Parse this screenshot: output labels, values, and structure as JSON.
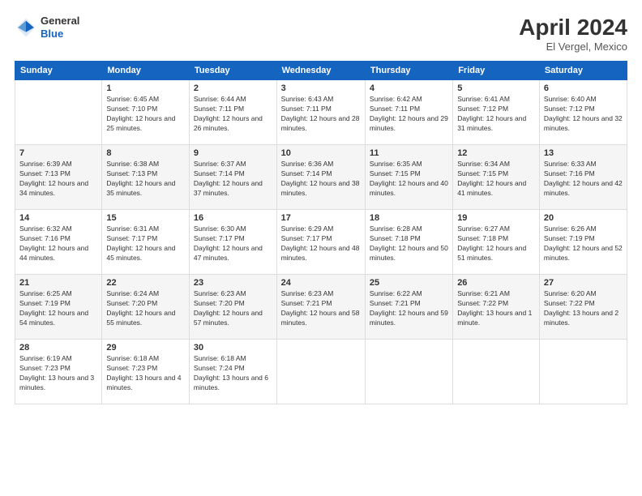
{
  "header": {
    "logo": {
      "general": "General",
      "blue": "Blue"
    },
    "title": "April 2024",
    "location": "El Vergel, Mexico"
  },
  "weekdays": [
    "Sunday",
    "Monday",
    "Tuesday",
    "Wednesday",
    "Thursday",
    "Friday",
    "Saturday"
  ],
  "weeks": [
    [
      {
        "day": "",
        "sunrise": "",
        "sunset": "",
        "daylight": ""
      },
      {
        "day": "1",
        "sunrise": "Sunrise: 6:45 AM",
        "sunset": "Sunset: 7:10 PM",
        "daylight": "Daylight: 12 hours and 25 minutes."
      },
      {
        "day": "2",
        "sunrise": "Sunrise: 6:44 AM",
        "sunset": "Sunset: 7:11 PM",
        "daylight": "Daylight: 12 hours and 26 minutes."
      },
      {
        "day": "3",
        "sunrise": "Sunrise: 6:43 AM",
        "sunset": "Sunset: 7:11 PM",
        "daylight": "Daylight: 12 hours and 28 minutes."
      },
      {
        "day": "4",
        "sunrise": "Sunrise: 6:42 AM",
        "sunset": "Sunset: 7:11 PM",
        "daylight": "Daylight: 12 hours and 29 minutes."
      },
      {
        "day": "5",
        "sunrise": "Sunrise: 6:41 AM",
        "sunset": "Sunset: 7:12 PM",
        "daylight": "Daylight: 12 hours and 31 minutes."
      },
      {
        "day": "6",
        "sunrise": "Sunrise: 6:40 AM",
        "sunset": "Sunset: 7:12 PM",
        "daylight": "Daylight: 12 hours and 32 minutes."
      }
    ],
    [
      {
        "day": "7",
        "sunrise": "Sunrise: 6:39 AM",
        "sunset": "Sunset: 7:13 PM",
        "daylight": "Daylight: 12 hours and 34 minutes."
      },
      {
        "day": "8",
        "sunrise": "Sunrise: 6:38 AM",
        "sunset": "Sunset: 7:13 PM",
        "daylight": "Daylight: 12 hours and 35 minutes."
      },
      {
        "day": "9",
        "sunrise": "Sunrise: 6:37 AM",
        "sunset": "Sunset: 7:14 PM",
        "daylight": "Daylight: 12 hours and 37 minutes."
      },
      {
        "day": "10",
        "sunrise": "Sunrise: 6:36 AM",
        "sunset": "Sunset: 7:14 PM",
        "daylight": "Daylight: 12 hours and 38 minutes."
      },
      {
        "day": "11",
        "sunrise": "Sunrise: 6:35 AM",
        "sunset": "Sunset: 7:15 PM",
        "daylight": "Daylight: 12 hours and 40 minutes."
      },
      {
        "day": "12",
        "sunrise": "Sunrise: 6:34 AM",
        "sunset": "Sunset: 7:15 PM",
        "daylight": "Daylight: 12 hours and 41 minutes."
      },
      {
        "day": "13",
        "sunrise": "Sunrise: 6:33 AM",
        "sunset": "Sunset: 7:16 PM",
        "daylight": "Daylight: 12 hours and 42 minutes."
      }
    ],
    [
      {
        "day": "14",
        "sunrise": "Sunrise: 6:32 AM",
        "sunset": "Sunset: 7:16 PM",
        "daylight": "Daylight: 12 hours and 44 minutes."
      },
      {
        "day": "15",
        "sunrise": "Sunrise: 6:31 AM",
        "sunset": "Sunset: 7:17 PM",
        "daylight": "Daylight: 12 hours and 45 minutes."
      },
      {
        "day": "16",
        "sunrise": "Sunrise: 6:30 AM",
        "sunset": "Sunset: 7:17 PM",
        "daylight": "Daylight: 12 hours and 47 minutes."
      },
      {
        "day": "17",
        "sunrise": "Sunrise: 6:29 AM",
        "sunset": "Sunset: 7:17 PM",
        "daylight": "Daylight: 12 hours and 48 minutes."
      },
      {
        "day": "18",
        "sunrise": "Sunrise: 6:28 AM",
        "sunset": "Sunset: 7:18 PM",
        "daylight": "Daylight: 12 hours and 50 minutes."
      },
      {
        "day": "19",
        "sunrise": "Sunrise: 6:27 AM",
        "sunset": "Sunset: 7:18 PM",
        "daylight": "Daylight: 12 hours and 51 minutes."
      },
      {
        "day": "20",
        "sunrise": "Sunrise: 6:26 AM",
        "sunset": "Sunset: 7:19 PM",
        "daylight": "Daylight: 12 hours and 52 minutes."
      }
    ],
    [
      {
        "day": "21",
        "sunrise": "Sunrise: 6:25 AM",
        "sunset": "Sunset: 7:19 PM",
        "daylight": "Daylight: 12 hours and 54 minutes."
      },
      {
        "day": "22",
        "sunrise": "Sunrise: 6:24 AM",
        "sunset": "Sunset: 7:20 PM",
        "daylight": "Daylight: 12 hours and 55 minutes."
      },
      {
        "day": "23",
        "sunrise": "Sunrise: 6:23 AM",
        "sunset": "Sunset: 7:20 PM",
        "daylight": "Daylight: 12 hours and 57 minutes."
      },
      {
        "day": "24",
        "sunrise": "Sunrise: 6:23 AM",
        "sunset": "Sunset: 7:21 PM",
        "daylight": "Daylight: 12 hours and 58 minutes."
      },
      {
        "day": "25",
        "sunrise": "Sunrise: 6:22 AM",
        "sunset": "Sunset: 7:21 PM",
        "daylight": "Daylight: 12 hours and 59 minutes."
      },
      {
        "day": "26",
        "sunrise": "Sunrise: 6:21 AM",
        "sunset": "Sunset: 7:22 PM",
        "daylight": "Daylight: 13 hours and 1 minute."
      },
      {
        "day": "27",
        "sunrise": "Sunrise: 6:20 AM",
        "sunset": "Sunset: 7:22 PM",
        "daylight": "Daylight: 13 hours and 2 minutes."
      }
    ],
    [
      {
        "day": "28",
        "sunrise": "Sunrise: 6:19 AM",
        "sunset": "Sunset: 7:23 PM",
        "daylight": "Daylight: 13 hours and 3 minutes."
      },
      {
        "day": "29",
        "sunrise": "Sunrise: 6:18 AM",
        "sunset": "Sunset: 7:23 PM",
        "daylight": "Daylight: 13 hours and 4 minutes."
      },
      {
        "day": "30",
        "sunrise": "Sunrise: 6:18 AM",
        "sunset": "Sunset: 7:24 PM",
        "daylight": "Daylight: 13 hours and 6 minutes."
      },
      {
        "day": "",
        "sunrise": "",
        "sunset": "",
        "daylight": ""
      },
      {
        "day": "",
        "sunrise": "",
        "sunset": "",
        "daylight": ""
      },
      {
        "day": "",
        "sunrise": "",
        "sunset": "",
        "daylight": ""
      },
      {
        "day": "",
        "sunrise": "",
        "sunset": "",
        "daylight": ""
      }
    ]
  ]
}
